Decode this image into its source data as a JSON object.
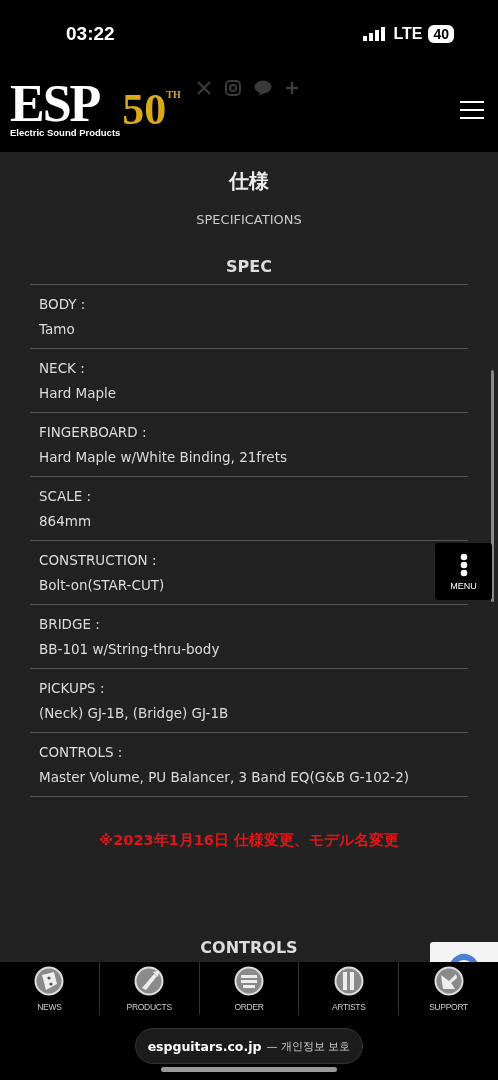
{
  "status_bar": {
    "time": "03:22",
    "network": "LTE",
    "battery": "40"
  },
  "header": {
    "logo": {
      "wordmark": "ESP",
      "tagline": "Electric Sound Products",
      "badge_number": "50",
      "badge_suffix": "TH"
    }
  },
  "section": {
    "title": "仕様",
    "subtitle": "SPECIFICATIONS",
    "spec_heading": "SPEC",
    "specs": [
      {
        "label": "BODY :",
        "value": "Tamo"
      },
      {
        "label": "NECK :",
        "value": "Hard Maple"
      },
      {
        "label": "FINGERBOARD :",
        "value": "Hard Maple w/White Binding, 21frets"
      },
      {
        "label": "SCALE :",
        "value": "864mm"
      },
      {
        "label": "CONSTRUCTION :",
        "value": "Bolt-on(STAR-CUT)"
      },
      {
        "label": "BRIDGE :",
        "value": "BB-101 w/String-thru-body"
      },
      {
        "label": "PICKUPS :",
        "value": "(Neck) GJ-1B, (Bridge) GJ-1B"
      },
      {
        "label": "CONTROLS :",
        "value": "Master Volume, PU Balancer, 3 Band EQ(G&B G-102-2)"
      }
    ],
    "notice": "※2023年1月16日 仕様変更、モデル名変更",
    "next_heading": "CONTROLS"
  },
  "floating_menu": {
    "label": "MENU"
  },
  "tab_bar": [
    {
      "label": "NEWS"
    },
    {
      "label": "PRODUCTS"
    },
    {
      "label": "ORDER"
    },
    {
      "label": "ARTISTS"
    },
    {
      "label": "SUPPORT"
    }
  ],
  "browser": {
    "domain": "espguitars.co.jp",
    "suffix": "— 개인정보 보호"
  }
}
